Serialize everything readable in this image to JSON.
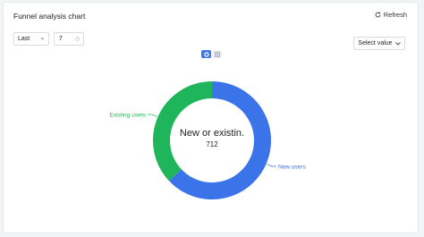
{
  "header": {
    "title": "Funnel analysis chart",
    "refresh_label": "Refresh"
  },
  "filters": {
    "period": "Last",
    "days": "7",
    "value_select": "Select value"
  },
  "view_toggle": {
    "donut_icon": "donut-chart-icon",
    "table_icon": "table-icon"
  },
  "chart_data": {
    "type": "pie",
    "donut": true,
    "center_label": "New or existin.",
    "center_value": "712",
    "slices": [
      {
        "label": "New users",
        "value": 0.63,
        "color": "#3b73e8"
      },
      {
        "label": "Existing users",
        "value": 0.37,
        "color": "#1fb55b"
      }
    ]
  }
}
